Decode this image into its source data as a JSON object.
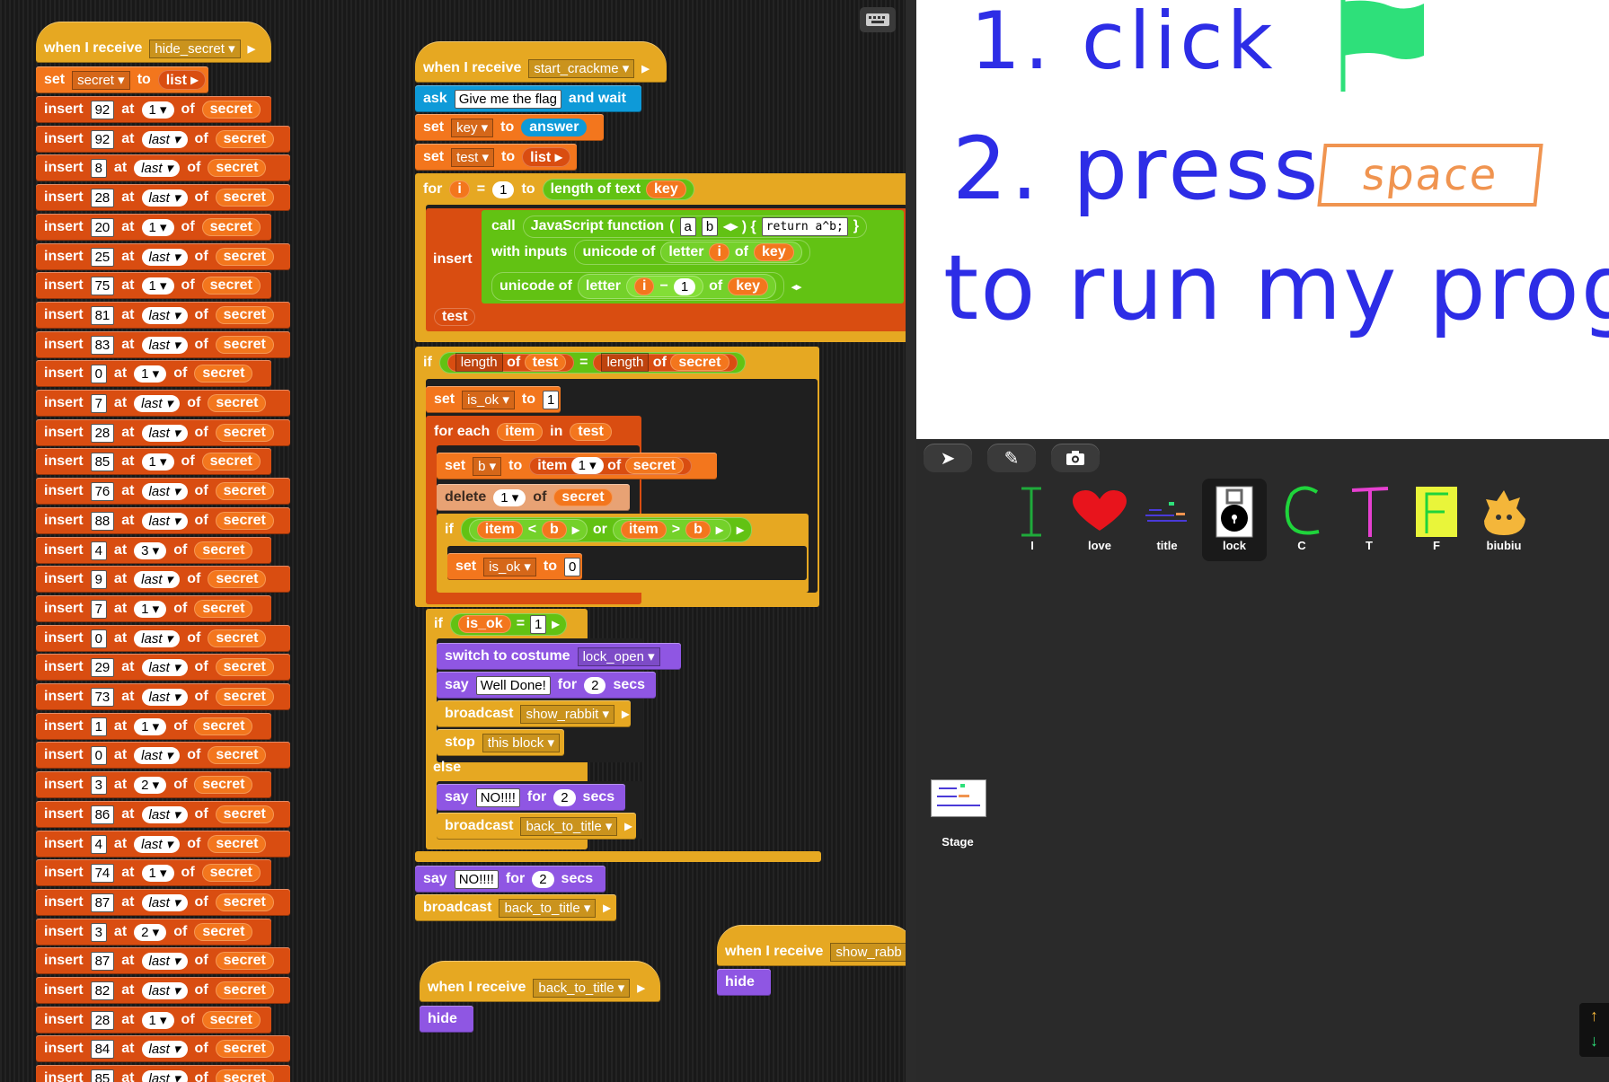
{
  "left_script": {
    "hat_label": "when I receive",
    "hat_message": "hide_secret",
    "set_label": "set",
    "set_var": "secret",
    "to_label": "to",
    "list_label": "list",
    "insert_label": "insert",
    "at_label": "at",
    "of_label": "of",
    "target": "secret",
    "inserts": [
      {
        "v": "92",
        "i": "1"
      },
      {
        "v": "92",
        "i": "last"
      },
      {
        "v": "8",
        "i": "last"
      },
      {
        "v": "28",
        "i": "last"
      },
      {
        "v": "20",
        "i": "1"
      },
      {
        "v": "25",
        "i": "last"
      },
      {
        "v": "75",
        "i": "1"
      },
      {
        "v": "81",
        "i": "last"
      },
      {
        "v": "83",
        "i": "last"
      },
      {
        "v": "0",
        "i": "1"
      },
      {
        "v": "7",
        "i": "last"
      },
      {
        "v": "28",
        "i": "last"
      },
      {
        "v": "85",
        "i": "1"
      },
      {
        "v": "76",
        "i": "last"
      },
      {
        "v": "88",
        "i": "last"
      },
      {
        "v": "4",
        "i": "3"
      },
      {
        "v": "9",
        "i": "last"
      },
      {
        "v": "7",
        "i": "1"
      },
      {
        "v": "0",
        "i": "last"
      },
      {
        "v": "29",
        "i": "last"
      },
      {
        "v": "73",
        "i": "last"
      },
      {
        "v": "1",
        "i": "1"
      },
      {
        "v": "0",
        "i": "last"
      },
      {
        "v": "3",
        "i": "2"
      },
      {
        "v": "86",
        "i": "last"
      },
      {
        "v": "4",
        "i": "last"
      },
      {
        "v": "74",
        "i": "1"
      },
      {
        "v": "87",
        "i": "last"
      },
      {
        "v": "3",
        "i": "2"
      },
      {
        "v": "87",
        "i": "last"
      },
      {
        "v": "82",
        "i": "last"
      },
      {
        "v": "28",
        "i": "1"
      },
      {
        "v": "84",
        "i": "last"
      },
      {
        "v": "85",
        "i": "last"
      }
    ]
  },
  "main_script": {
    "hat_label": "when I receive",
    "hat_message": "start_crackme",
    "ask_label": "ask",
    "ask_text": "Give me the flag",
    "and_wait": "and wait",
    "set_label": "set",
    "to_label": "to",
    "set_key_var": "key",
    "answer": "answer",
    "set_test_var": "test",
    "list_label": "list",
    "for_label": "for",
    "i_var": "i",
    "eq": "=",
    "one": "1",
    "length_of_text": "length of text",
    "key": "key",
    "insert_label": "insert",
    "call_label": "call",
    "js_function": "JavaScript function",
    "param_a": "a",
    "param_b": "b",
    "js_body": "return a^b;",
    "with_inputs": "with inputs",
    "unicode_of": "unicode of",
    "letter": "letter",
    "of_label": "of",
    "minus": "−",
    "test": "test",
    "if_label": "if",
    "length": "length",
    "secret": "secret",
    "set_isok_var": "is_ok",
    "isok_one": "1",
    "for_each": "for each",
    "item": "item",
    "in_label": "in",
    "set_b_var": "b",
    "item_label": "item",
    "delete_label": "delete",
    "lt": "<",
    "gt": ">",
    "or_label": "or",
    "b": "b",
    "isok_zero": "0",
    "is_ok": "is_ok",
    "switch_costume": "switch to costume",
    "costume": "lock_open",
    "say_label": "say",
    "well_done": "Well Done!",
    "for_secs_for": "for",
    "two": "2",
    "secs": "secs",
    "broadcast_label": "broadcast",
    "show_rabbit": "show_rabbit",
    "stop_label": "stop",
    "this_block": "this block",
    "else_label": "else",
    "no_msg": "NO!!!!",
    "back_to_title": "back_to_title"
  },
  "small_scripts": {
    "back_hat": "when I receive",
    "back_msg": "back_to_title",
    "hide": "hide",
    "show_hat": "when I receive",
    "show_msg": "show_rabb"
  },
  "stage": {
    "line1": "1. click",
    "line2": "2. press",
    "space": "space",
    "line3": "to run my progra"
  },
  "tools": {
    "arrow": "➤",
    "brush": "✎",
    "camera": "📷"
  },
  "sprites": [
    {
      "name": "I"
    },
    {
      "name": "love"
    },
    {
      "name": "title"
    },
    {
      "name": "lock"
    },
    {
      "name": "C"
    },
    {
      "name": "T"
    },
    {
      "name": "F"
    },
    {
      "name": "biubiu"
    }
  ],
  "stage_corral": {
    "label": "Stage"
  },
  "keyboard_icon": "keyboard-icon"
}
